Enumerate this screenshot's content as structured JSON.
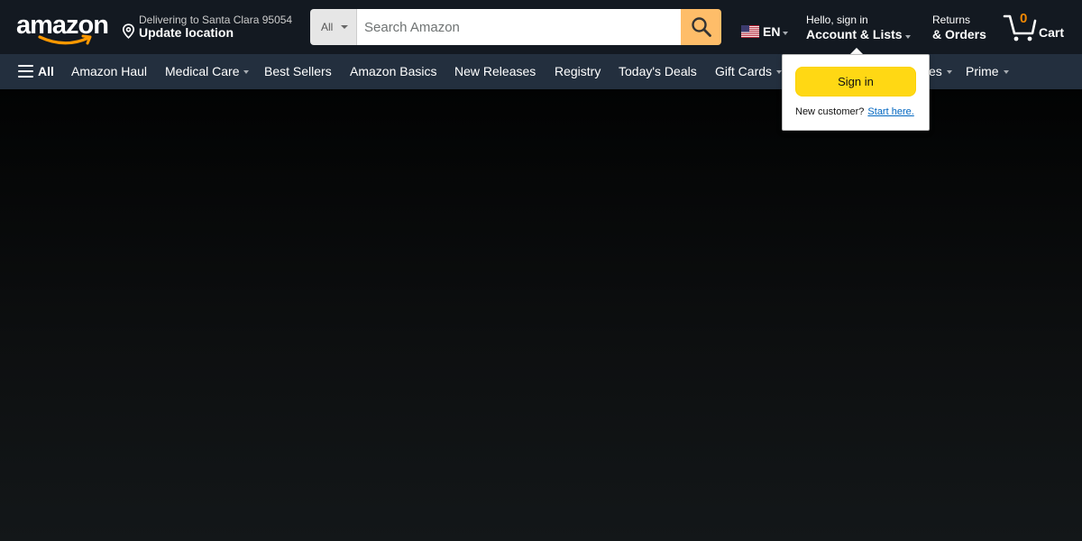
{
  "header": {
    "logo_text": "amazon",
    "location": {
      "line1": "Delivering to Santa Clara 95054",
      "line2": "Update location"
    },
    "search": {
      "department": "All",
      "placeholder": "Search Amazon"
    },
    "language": {
      "code": "EN"
    },
    "account": {
      "line1": "Hello, sign in",
      "line2": "Account & Lists"
    },
    "returns": {
      "line1": "Returns",
      "line2": "& Orders"
    },
    "cart": {
      "count": "0",
      "label": "Cart"
    }
  },
  "nav": {
    "all_label": "All",
    "items": [
      {
        "label": "Amazon Haul"
      },
      {
        "label": "Medical Care"
      },
      {
        "label": "Best Sellers"
      },
      {
        "label": "Amazon Basics"
      },
      {
        "label": "New Releases"
      },
      {
        "label": "Registry"
      },
      {
        "label": "Today's Deals"
      },
      {
        "label": "Gift Cards"
      },
      {
        "label": "es"
      },
      {
        "label": "Prime"
      }
    ]
  },
  "flyout": {
    "signin_label": "Sign in",
    "new_customer_text": "New customer?",
    "start_here_label": "Start here."
  },
  "colors": {
    "topbar": "#131921",
    "navbar": "#232f3e",
    "search_button": "#febd69",
    "signin_button": "#ffd814",
    "cart_count": "#f08804",
    "link": "#0066c0"
  }
}
